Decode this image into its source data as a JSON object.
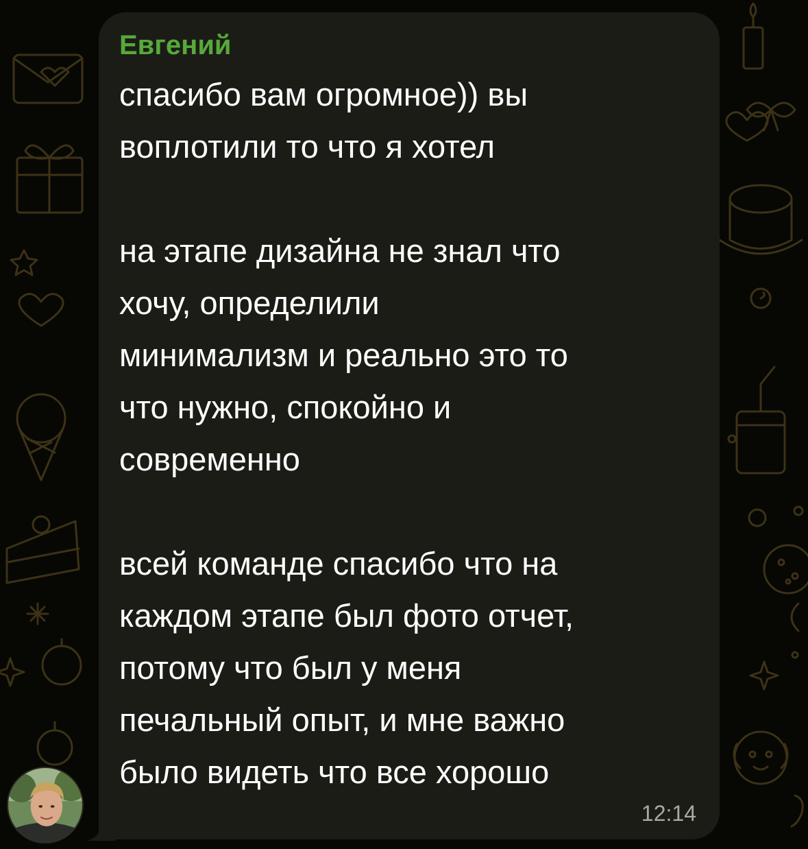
{
  "message": {
    "sender": "Евгений",
    "lines": [
      "спасибо вам огромное)) вы",
      "воплотили то что я хотел",
      "",
      "на этапе дизайна не знал что",
      "хочу, определили",
      "минимализм и реально это то",
      "что нужно, спокойно и",
      "современно",
      "",
      "всей команде спасибо что на",
      "каждом этапе был фото отчет,",
      "потому что был у меня",
      "печальный опыт, и мне важно",
      "было видеть что все хорошо"
    ],
    "time": "12:14"
  },
  "theme": {
    "background": "#070704",
    "bubble": "#1c1c17",
    "sender_color": "#56a93a",
    "text_color": "#ffffff",
    "time_color": "#a9a9a4",
    "doodle_color": "#3a2f14"
  },
  "avatar": {
    "icon": "user-photo-avatar"
  }
}
